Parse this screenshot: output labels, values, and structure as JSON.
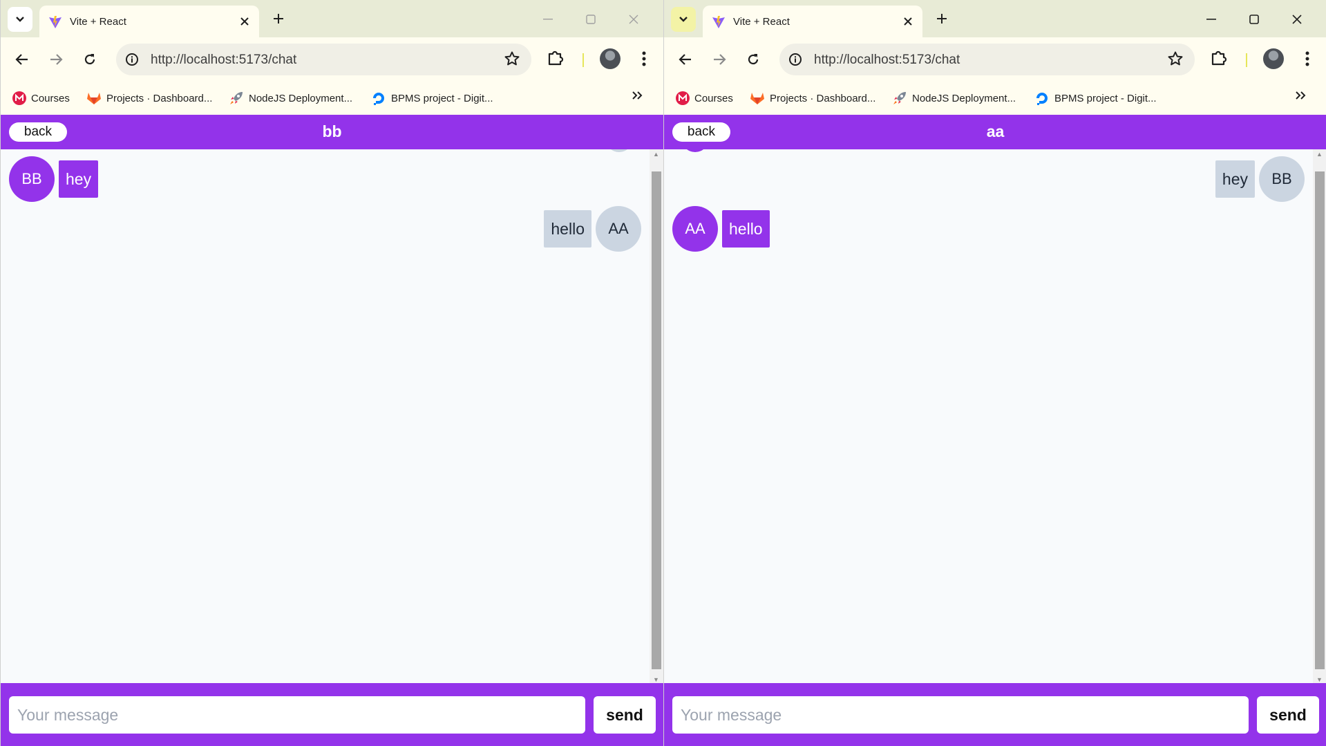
{
  "windows": [
    {
      "tab_title": "Vite + React",
      "url": "http://localhost:5173/chat",
      "bookmarks": [
        "Courses",
        "Projects · Dashboard...",
        "NodeJS Deployment...",
        "BPMS project - Digit..."
      ],
      "back_label": "back",
      "chat_title": "bb",
      "messages": [
        {
          "side": "left",
          "initials": "BB",
          "text": "hey",
          "style": "purple"
        },
        {
          "side": "right",
          "initials": "AA",
          "text": "hello",
          "style": "gray"
        }
      ],
      "input_placeholder": "Your message",
      "send_label": "send"
    },
    {
      "tab_title": "Vite + React",
      "url": "http://localhost:5173/chat",
      "bookmarks": [
        "Courses",
        "Projects · Dashboard...",
        "NodeJS Deployment...",
        "BPMS project - Digit..."
      ],
      "back_label": "back",
      "chat_title": "aa",
      "messages": [
        {
          "side": "right",
          "initials": "BB",
          "text": "hey",
          "style": "gray"
        },
        {
          "side": "left",
          "initials": "AA",
          "text": "hello",
          "style": "purple"
        }
      ],
      "input_placeholder": "Your message",
      "send_label": "send"
    }
  ],
  "icons": {
    "tablist": "chevron-down-icon",
    "favicon": "vite-logo-icon",
    "close": "close-icon",
    "new_tab": "plus-icon",
    "back": "arrow-left-icon",
    "forward": "arrow-right-icon",
    "reload": "reload-icon",
    "site_info": "info-icon",
    "bookmark_star": "star-icon",
    "extensions": "puzzle-icon",
    "menu": "kebab-menu-icon",
    "more_bookmarks": "double-chevron-right-icon"
  },
  "colors": {
    "accent": "#9333ea",
    "bubble_gray": "#cbd5e1",
    "chat_background": "#f8fafc",
    "browser_chrome": "#fffdf0"
  }
}
